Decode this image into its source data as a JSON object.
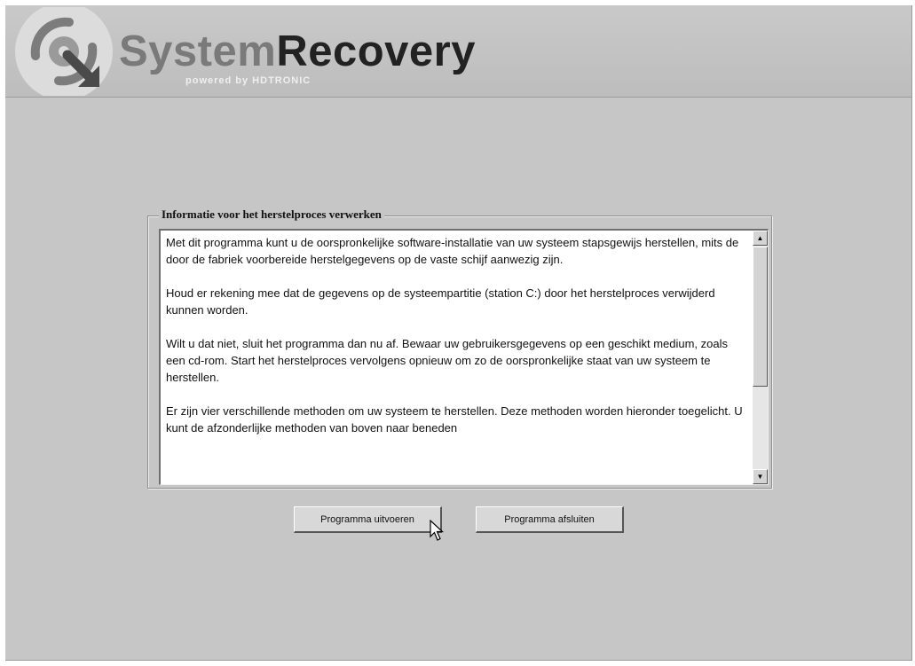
{
  "header": {
    "brand_part1": "System",
    "brand_part2": "Recovery",
    "tagline": "powered by HDTRONIC",
    "logo_icon": "recovery-disc-arrow-icon"
  },
  "info_panel": {
    "title": "Informatie voor het herstelproces verwerken",
    "paragraphs": [
      "Met dit programma kunt u de oorspronkelijke software-installatie van uw systeem stapsgewijs herstellen, mits de door de fabriek voorbereide herstelgegevens op de vaste schijf aanwezig zijn.",
      "Houd er rekening mee dat de gegevens op de systeempartitie (station C:) door het herstelproces verwijderd kunnen worden.",
      "Wilt u dat niet, sluit het programma dan nu af. Bewaar uw gebruikersgegevens op een geschikt medium, zoals een cd-rom. Start het herstelproces vervolgens opnieuw om zo de oorspronkelijke staat van uw systeem te herstellen.",
      "Er zijn vier verschillende methoden om uw systeem te herstellen. Deze methoden worden hieronder toegelicht. U kunt de afzonderlijke methoden van boven naar beneden"
    ],
    "scroll_up_icon": "▲",
    "scroll_down_icon": "▼"
  },
  "buttons": {
    "run_label": "Programma uitvoeren",
    "exit_label": "Programma afsluiten"
  },
  "colors": {
    "background": "#c6c6c6",
    "brand_light": "#7a7a7a",
    "brand_dark": "#222222"
  }
}
